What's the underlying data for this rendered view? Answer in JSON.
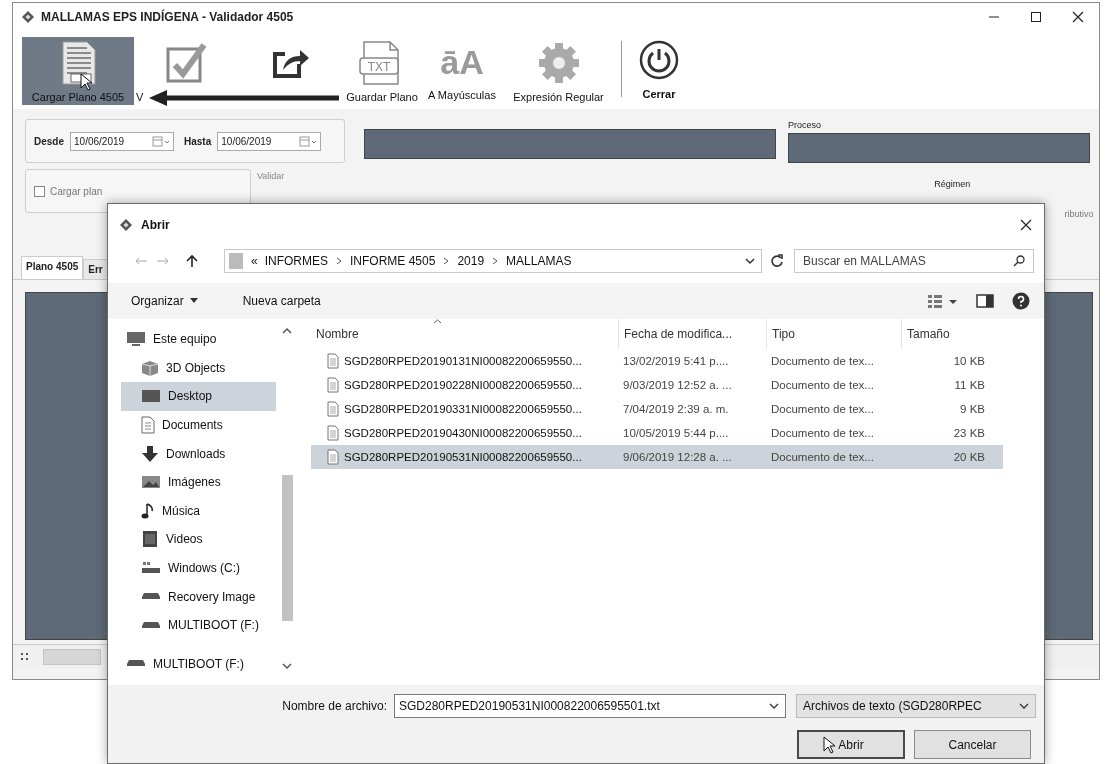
{
  "window": {
    "title": "MALLAMAS EPS INDÍGENA - Validador 4505"
  },
  "toolbar": [
    {
      "kind": "load",
      "label": "Cargar Plano 4505",
      "selected": true
    },
    {
      "kind": "validate",
      "label": "V",
      "selected": false
    },
    {
      "kind": "export",
      "selected": false
    },
    {
      "kind": "save",
      "label": "Guardar Plano",
      "glyph": "TXT",
      "selected": false
    },
    {
      "kind": "uppercase",
      "label": "A Mayúsculas",
      "glyph": "āA",
      "selected": false
    },
    {
      "kind": "regex",
      "label": "Expresión Regular",
      "selected": false
    },
    {
      "kind": "close",
      "label": "Cerrar",
      "selected": false
    }
  ],
  "annotation": {
    "kind": "arrow"
  },
  "filters": {
    "from_label": "Desde",
    "from_value": "10/06/2019",
    "to_label": "Hasta",
    "to_value": "10/06/2019",
    "process_label": "Proceso"
  },
  "options": {
    "load_plan": {
      "label": "Cargar plan",
      "checked": false
    },
    "validate_label": "Validar",
    "regime_label": "Régimen",
    "regime_option": "ributivo"
  },
  "tabs": [
    {
      "label": "Plano 4505",
      "selected": true
    },
    {
      "label": "Err",
      "selected": false
    }
  ],
  "dialog": {
    "title": "Abrir",
    "address": {
      "overflow": "«",
      "path": [
        "INFORMES",
        "INFORME 4505",
        "2019",
        "MALLAMAS"
      ]
    },
    "search": {
      "placeholder": "Buscar en MALLAMAS"
    },
    "commands": [
      {
        "label": "Organizar",
        "kind": "menu"
      },
      {
        "label": "Nueva carpeta",
        "kind": "plain"
      }
    ],
    "nav": [
      {
        "label": "Este equipo",
        "kind": "computer",
        "selected": false,
        "children": [
          {
            "label": "3D Objects",
            "kind": "cube",
            "selected": false
          },
          {
            "label": "Desktop",
            "kind": "desktop",
            "selected": true
          },
          {
            "label": "Documents",
            "kind": "document",
            "selected": false
          },
          {
            "label": "Downloads",
            "kind": "download",
            "selected": false
          },
          {
            "label": "Imágenes",
            "kind": "pictures",
            "selected": false
          },
          {
            "label": "Música",
            "kind": "music",
            "selected": false
          },
          {
            "label": "Videos",
            "kind": "video",
            "selected": false
          },
          {
            "label": "Windows (C:)",
            "kind": "system-drive",
            "selected": false
          },
          {
            "label": "Recovery Image",
            "kind": "drive",
            "selected": false
          },
          {
            "label": "MULTIBOOT (F:)",
            "kind": "drive",
            "selected": false
          }
        ]
      },
      {
        "label": "MULTIBOOT (F:)",
        "kind": "drive",
        "selected": false
      }
    ],
    "columns": [
      "Nombre",
      "Fecha de modifica...",
      "Tipo",
      "Tamaño"
    ],
    "files": [
      {
        "name": "SGD280RPED20190131NI00082200659550...",
        "modified": "13/02/2019 5:41 p....",
        "type": "Documento de tex...",
        "size": "10 KB",
        "selected": false
      },
      {
        "name": "SGD280RPED20190228NI00082200659550...",
        "modified": "9/03/2019 12:52 a. ...",
        "type": "Documento de tex...",
        "size": "11 KB",
        "selected": false
      },
      {
        "name": "SGD280RPED20190331NI00082200659550...",
        "modified": "7/04/2019 2:39 a. m.",
        "type": "Documento de tex...",
        "size": "9 KB",
        "selected": false
      },
      {
        "name": "SGD280RPED20190430NI00082200659550...",
        "modified": "10/05/2019 5:44 p....",
        "type": "Documento de tex...",
        "size": "23 KB",
        "selected": false
      },
      {
        "name": "SGD280RPED20190531NI00082200659550...",
        "modified": "9/06/2019 12:28 a. ...",
        "type": "Documento de tex...",
        "size": "20 KB",
        "selected": true
      }
    ],
    "file_name": {
      "label": "Nombre de archivo:",
      "value": "SGD280RPED20190531NI000822006595501.txt"
    },
    "file_type": {
      "value": "Archivos de texto (SGD280RPEC"
    },
    "buttons": [
      "Abrir",
      "Cancelar"
    ]
  }
}
